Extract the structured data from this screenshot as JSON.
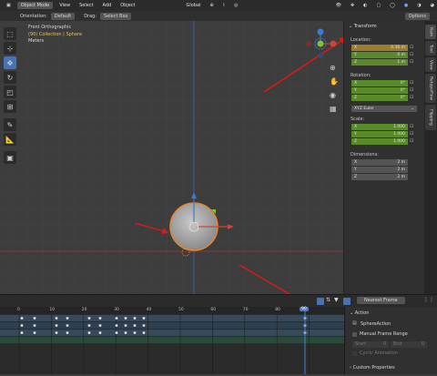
{
  "header": {
    "mode": "Object Mode",
    "menus": [
      "View",
      "Select",
      "Add",
      "Object"
    ],
    "transform_orientation": "Global",
    "options_label": "Options"
  },
  "subheader": {
    "orientation_label": "Orientation:",
    "orientation_value": "Default",
    "drag_label": "Drag:",
    "drag_value": "Select Box"
  },
  "viewport_info": {
    "view": "Front Orthographic",
    "collection": "(90) Collection | Sphere",
    "units": "Meters"
  },
  "npanel": {
    "transform_title": "Transform",
    "location_label": "Location:",
    "location": [
      {
        "axis": "X",
        "value": "0.36 m"
      },
      {
        "axis": "Y",
        "value": "0 m"
      },
      {
        "axis": "Z",
        "value": "1 m"
      }
    ],
    "rotation_label": "Rotation:",
    "rotation": [
      {
        "axis": "X",
        "value": "0°"
      },
      {
        "axis": "Y",
        "value": "0°"
      },
      {
        "axis": "Z",
        "value": "0°"
      }
    ],
    "euler_mode": "XYZ Euler",
    "scale_label": "Scale:",
    "scale": [
      {
        "axis": "X",
        "value": "1.000"
      },
      {
        "axis": "Y",
        "value": "1.000"
      },
      {
        "axis": "Z",
        "value": "1.000"
      }
    ],
    "dimensions_label": "Dimensions:",
    "dimensions": [
      {
        "axis": "X",
        "value": "2 m"
      },
      {
        "axis": "Y",
        "value": "2 m"
      },
      {
        "axis": "Z",
        "value": "2 m"
      }
    ]
  },
  "right_tabs": [
    "Item",
    "Tool",
    "View",
    "RetopoFlow",
    "Flipping"
  ],
  "timeline": {
    "snap_mode": "Nearest Frame",
    "frame_numbers": [
      "0",
      "10",
      "20",
      "30",
      "40",
      "50",
      "60",
      "70",
      "80",
      "90"
    ],
    "current_frame": "90"
  },
  "action_panel": {
    "title": "Action",
    "action_name": "SphereAction",
    "manual_range": "Manual Frame Range",
    "start_label": "Start",
    "start_value": "0",
    "end_label": "End",
    "end_value": "0",
    "cyclic": "Cyclic Animation",
    "custom_props": "Custom Properties"
  },
  "colors": {
    "selection_orange": "#e8862d",
    "location_field": "#9c7d2e",
    "green_field": "#5a8a2a",
    "x_axis": "#c9453c",
    "y_axis": "#7fc33a",
    "z_axis": "#3b7cd1",
    "arrow_red": "#e01818",
    "frame_blue": "#4a7ed8"
  }
}
